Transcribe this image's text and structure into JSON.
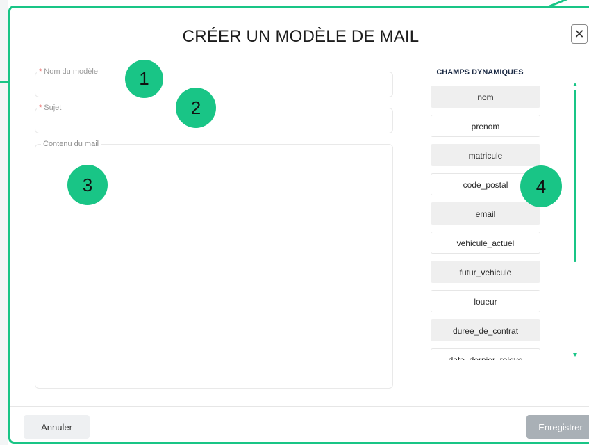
{
  "modal": {
    "title": "CRÉER UN MODÈLE DE MAIL",
    "close_icon": "close-icon",
    "close_glyph": "✕"
  },
  "form": {
    "name_field": {
      "label": "Nom du modèle",
      "required_mark": "*",
      "value": ""
    },
    "subject_field": {
      "label": "Sujet",
      "required_mark": "*",
      "value": ""
    },
    "content_field": {
      "label": "Contenu du mail",
      "value": ""
    }
  },
  "dynamic_fields": {
    "title": "CHAMPS DYNAMIQUES",
    "items": [
      "nom",
      "prenom",
      "matricule",
      "code_postal",
      "email",
      "vehicule_actuel",
      "futur_vehicule",
      "loueur",
      "duree_de_contrat",
      "date_dernier_releve"
    ]
  },
  "annotations": [
    "1",
    "2",
    "3",
    "4"
  ],
  "footer": {
    "cancel_label": "Annuler",
    "save_label": "Enregistrer"
  },
  "colors": {
    "accent": "#19c586",
    "required": "#e53935",
    "save_disabled": "#a9b0b6"
  }
}
